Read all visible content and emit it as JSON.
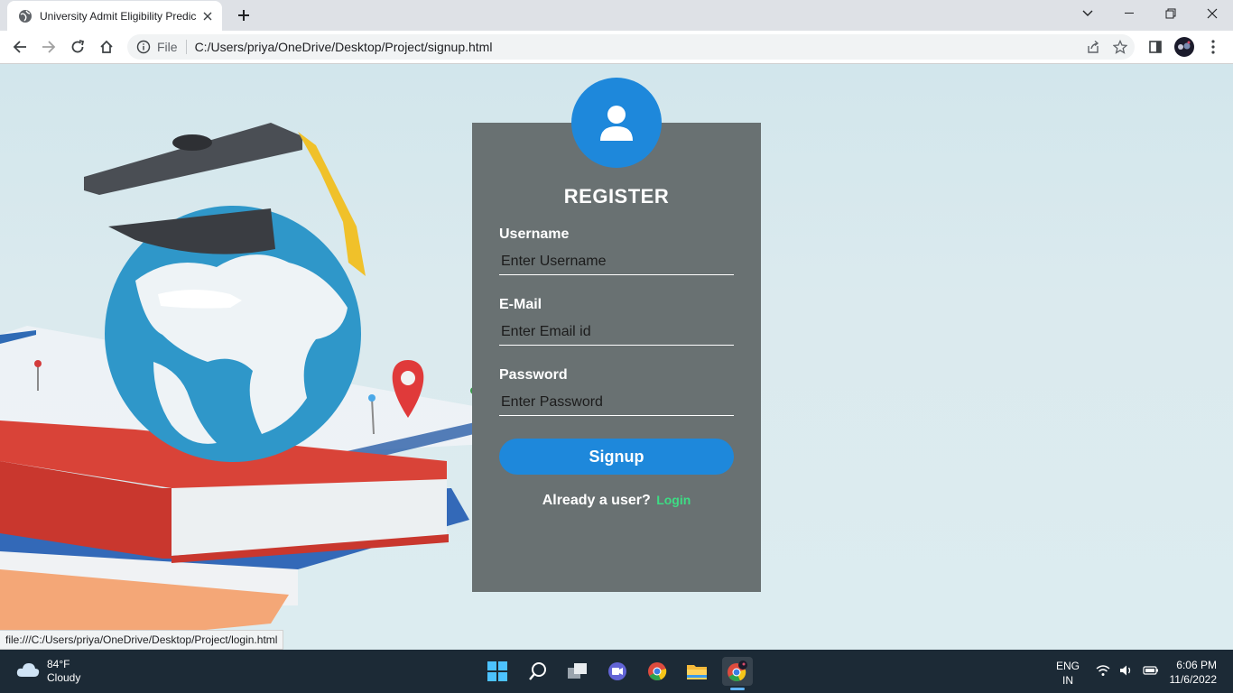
{
  "browser": {
    "tab_title": "University Admit Eligibility Predic",
    "url_scheme": "File",
    "url": "C:/Users/priya/OneDrive/Desktop/Project/signup.html",
    "status_url": "file:///C:/Users/priya/OneDrive/Desktop/Project/login.html"
  },
  "form": {
    "heading": "REGISTER",
    "username_label": "Username",
    "username_placeholder": "Enter Username",
    "email_label": "E-Mail",
    "email_placeholder": "Enter Email id",
    "password_label": "Password",
    "password_placeholder": "Enter Password",
    "signup_label": "Signup",
    "already_text": "Already a user?",
    "login_link": "Login"
  },
  "colors": {
    "accent": "#1e88db",
    "card": "#697172",
    "link": "#3ddc84"
  },
  "taskbar": {
    "temperature": "84°F",
    "weather": "Cloudy",
    "lang_top": "ENG",
    "lang_bottom": "IN",
    "time": "6:06 PM",
    "date": "11/6/2022",
    "apps": [
      "start-icon",
      "search-icon",
      "task-view-icon",
      "teams-chat-icon",
      "chrome-icon",
      "file-explorer-icon",
      "chrome-profile-icon"
    ]
  }
}
